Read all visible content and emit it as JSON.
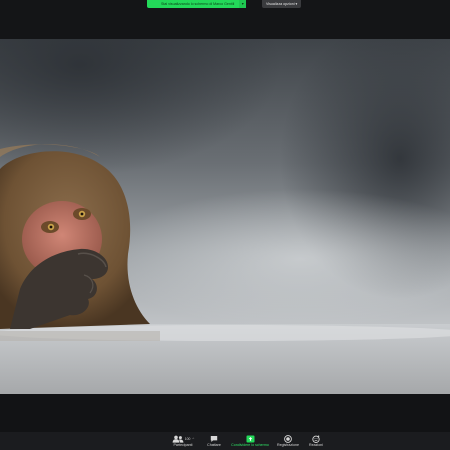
{
  "top_bar": {
    "share_banner": "Stai visualizzando lo schermo di Marco Gentili",
    "share_caret": "▾",
    "view_options": "Visualizza opzioni ▾"
  },
  "shared_image": {
    "subject": "monkey-photo",
    "palette": {
      "background": "#5d6369",
      "water": "#c4c7c9",
      "fur": "#7a5d3e",
      "face": "#c0786a"
    }
  },
  "toolbar": {
    "participants": {
      "label": "Partecipanti",
      "count": "100",
      "chevron": "^"
    },
    "chat": {
      "label": "Chattare"
    },
    "share": {
      "label": "Condividere lo schermo"
    },
    "record": {
      "label": "Registrazione"
    },
    "reactions": {
      "label": "Reazioni"
    }
  },
  "colors": {
    "accent_green": "#23d959",
    "toolbar_bg": "#1b1c1f"
  }
}
